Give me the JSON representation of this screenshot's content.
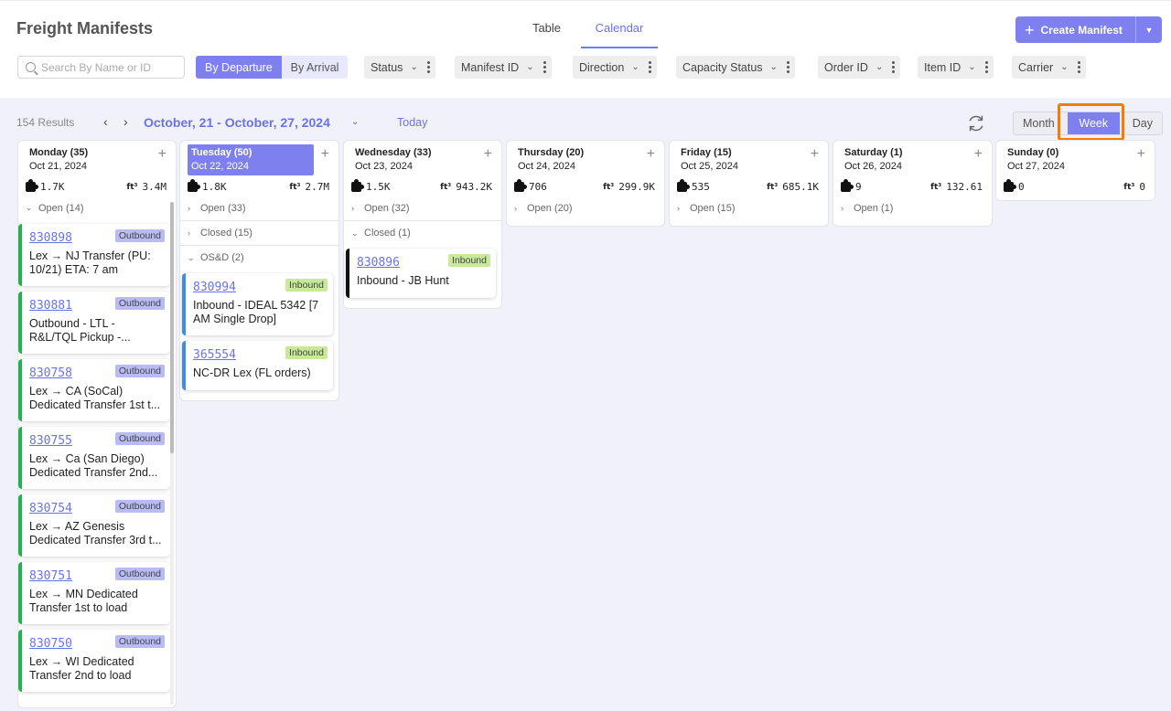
{
  "app_title": "Freight Manifests",
  "view_tabs": [
    {
      "label": "Table"
    },
    {
      "label": "Calendar"
    }
  ],
  "create_button": {
    "label": "Create Manifest"
  },
  "search": {
    "placeholder": "Search By Name or ID"
  },
  "toggle": {
    "departure": "By Departure",
    "arrival": "By Arrival"
  },
  "filters": [
    "Status",
    "Manifest ID",
    "Direction",
    "Capacity Status",
    "Order ID",
    "Item ID",
    "Carrier"
  ],
  "toolbar": {
    "results": "154 Results",
    "range": "October, 21 - October, 27, 2024",
    "today": "Today",
    "views": [
      "Month",
      "Week",
      "Day"
    ]
  },
  "days": [
    {
      "label": "Monday (35)",
      "date": "Oct 21, 2024",
      "pieces": "1.7K",
      "volume": "3.4M"
    },
    {
      "label": "Tuesday (50)",
      "date": "Oct 22, 2024",
      "pieces": "1.8K",
      "volume": "2.7M"
    },
    {
      "label": "Wednesday (33)",
      "date": "Oct 23, 2024",
      "pieces": "1.5K",
      "volume": "943.2K"
    },
    {
      "label": "Thursday (20)",
      "date": "Oct 24, 2024",
      "pieces": "706",
      "volume": "299.9K"
    },
    {
      "label": "Friday (15)",
      "date": "Oct 25, 2024",
      "pieces": "535",
      "volume": "685.1K"
    },
    {
      "label": "Saturday (1)",
      "date": "Oct 26, 2024",
      "pieces": "9",
      "volume": "132.61"
    },
    {
      "label": "Sunday (0)",
      "date": "Oct 27, 2024",
      "pieces": "0",
      "volume": "0"
    }
  ],
  "volume_unit": "ft³",
  "groups": {
    "mon_open": "Open (14)",
    "tue_open": "Open (33)",
    "tue_closed": "Closed (15)",
    "tue_osd": "OS&D (2)",
    "wed_open": "Open (32)",
    "wed_closed": "Closed (1)",
    "thu_open": "Open (20)",
    "fri_open": "Open (15)",
    "sat_open": "Open (1)"
  },
  "cards": {
    "mon": [
      {
        "id": "830898",
        "badge": "Outbound",
        "title": "Lex → NJ Transfer (PU: 10/21) ETA: 7 am"
      },
      {
        "id": "830881",
        "badge": "Outbound",
        "title": "Outbound - LTL - R&L/TQL Pickup -..."
      },
      {
        "id": "830758",
        "badge": "Outbound",
        "title": "Lex → CA (SoCal) Dedicated Transfer 1st t..."
      },
      {
        "id": "830755",
        "badge": "Outbound",
        "title": "Lex → Ca (San Diego) Dedicated Transfer 2nd..."
      },
      {
        "id": "830754",
        "badge": "Outbound",
        "title": "Lex → AZ Genesis Dedicated Transfer 3rd t..."
      },
      {
        "id": "830751",
        "badge": "Outbound",
        "title": "Lex → MN Dedicated Transfer 1st to load"
      },
      {
        "id": "830750",
        "badge": "Outbound",
        "title": "Lex → WI Dedicated Transfer 2nd to load"
      }
    ],
    "tue": [
      {
        "id": "830994",
        "badge": "Inbound",
        "title": "Inbound - IDEAL 5342 [7 AM Single Drop]"
      },
      {
        "id": "365554",
        "badge": "Inbound",
        "title": "NC-DR Lex (FL orders)"
      }
    ],
    "wed": [
      {
        "id": "830896",
        "badge": "Inbound",
        "title": "Inbound - JB Hunt"
      }
    ]
  },
  "colors": {
    "accent": "#7d80ee",
    "outbound_bar": "#22b14c",
    "inbound_bar": "#3b8de8",
    "closed_bar": "#111111",
    "highlight": "#f57c00"
  }
}
